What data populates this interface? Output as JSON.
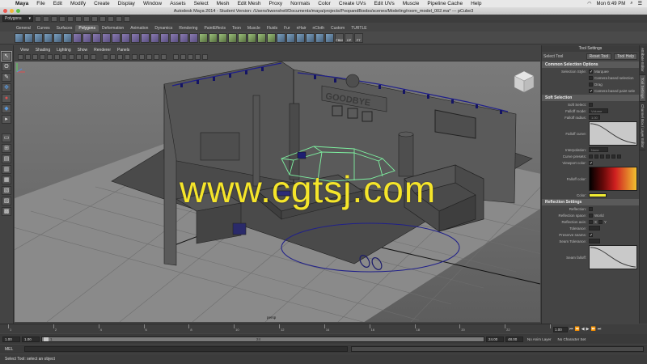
{
  "macbar": {
    "app": "Maya",
    "menus": [
      "File",
      "Edit",
      "Modify",
      "Create",
      "Display",
      "Window",
      "Assets",
      "Select",
      "Mesh",
      "Edit Mesh",
      "Proxy",
      "Normals",
      "Color",
      "Create UVs",
      "Edit UVs",
      "Muscle",
      "Pipeline Cache",
      "Help"
    ],
    "clock": "Mon 6:49 PM"
  },
  "window": {
    "title": "Autodesk Maya 2014 - Student Version: /Users/kwonshell/Documents/maya/projects/PoopandBoobs/scenes/Modeling/room_model_002.ma* --- pCube3"
  },
  "statusline": {
    "menu_set": "Polygons"
  },
  "shelf": {
    "tabs": [
      "General",
      "Curves",
      "Surfaces",
      "Polygons",
      "Deformation",
      "Animation",
      "Dynamics",
      "Rendering",
      "PaintEffects",
      "Toon",
      "Muscle",
      "Fluids",
      "Fur",
      "nHair",
      "nCloth",
      "Custom",
      "TURTLE"
    ],
    "active_tab": "Polygons",
    "icon_labels": [
      "FBM",
      "CP",
      "FT"
    ]
  },
  "viewport": {
    "menus": [
      "View",
      "Shading",
      "Lighting",
      "Show",
      "Renderer",
      "Panels"
    ],
    "camera_label": "persp",
    "sign_text": "GOODBYE",
    "watermark": "www.cgtsj.com"
  },
  "tool_settings": {
    "panel_title": "Tool Settings",
    "tool_name": "Select Tool",
    "reset_button": "Reset Tool",
    "help_button": "Tool Help",
    "common_section": "Common Selection Options",
    "selection_style_label": "Selection Style:",
    "selection_style_value": "Marquee",
    "camera_based_selection": "Camera based selection",
    "drag": "Drag",
    "camera_based_paint": "Camera based paint sele",
    "soft_section": "Soft Selection",
    "soft_select_label": "Soft Select:",
    "falloff_mode_label": "Falloff mode:",
    "falloff_mode_value": "Volume",
    "falloff_radius_label": "Falloff radius:",
    "falloff_radius_value": "1.00",
    "falloff_curve_label": "Falloff curve:",
    "interpolation_label": "Interpolation:",
    "interpolation_value": "None",
    "curve_presets_label": "Curve presets:",
    "viewport_color_label": "Viewport color:",
    "falloff_color_label": "Falloff color:",
    "color_label": "Color:",
    "color_value": "#f2ec32",
    "reflection_section": "Reflection Settings",
    "reflection_label": "Reflection:",
    "reflection_space_label": "Reflection space:",
    "reflection_space_value": "World",
    "reflection_axis_label": "Reflection axis:",
    "reflection_axis_x": "X",
    "reflection_axis_y": "Y",
    "tolerance_label": "Tolerance:",
    "preserve_seams_label": "Preserve seams:",
    "seam_tolerance_label": "Seam Tolerance:",
    "seam_falloff_label": "Seam falloff:"
  },
  "side_tabs": [
    "Attribute Editor",
    "Tool Settings",
    "Channel Box / Layer Editor"
  ],
  "timeline": {
    "ticks": [
      "1",
      "2",
      "4",
      "6",
      "8",
      "10",
      "12",
      "14",
      "16",
      "18",
      "20",
      "22",
      "24"
    ],
    "current_frame": "1.00",
    "playback_buttons": [
      "⏮",
      "⏪",
      "◀",
      "▶",
      "⏩",
      "⏭"
    ]
  },
  "range": {
    "start": "1.00",
    "anim_start": "1.00",
    "slider_value": "1",
    "slider_end_label": "24",
    "end": "24.00",
    "anim_end": "48.00",
    "anim_layer": "No Anim Layer",
    "character_set": "No Character Set"
  },
  "cmdline": {
    "label": "MEL"
  },
  "helpline": {
    "text": "Select Tool: select an object"
  }
}
